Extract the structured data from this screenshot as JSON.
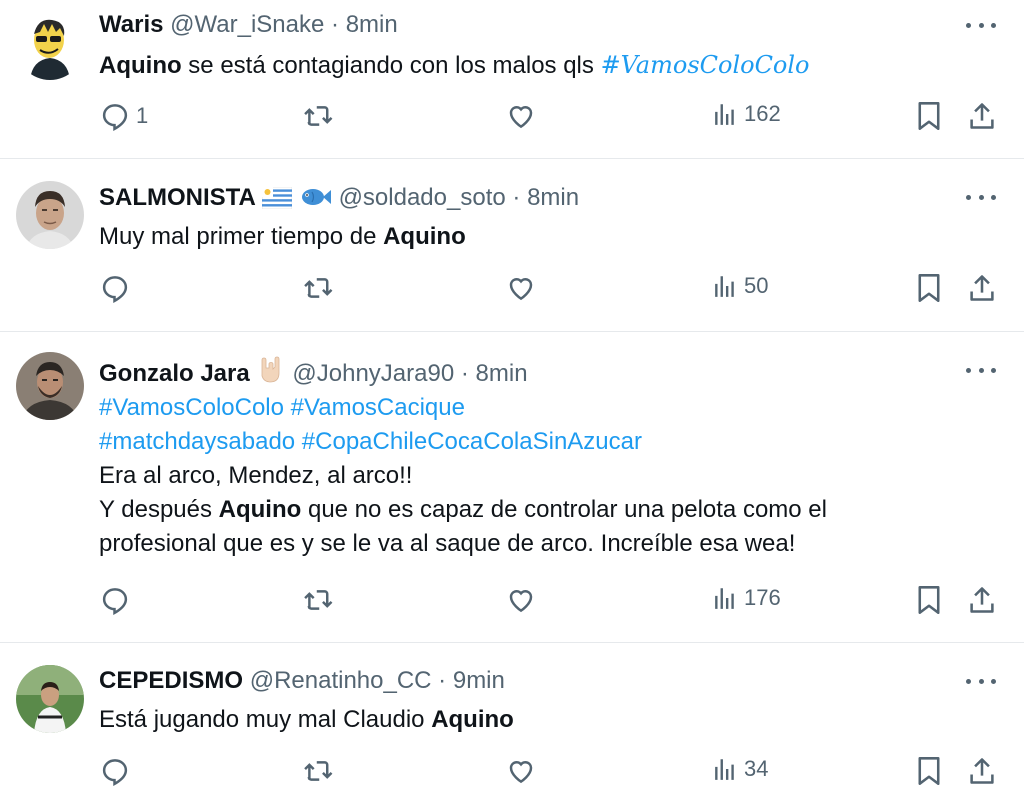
{
  "tweets": [
    {
      "name": "Waris",
      "handle": "@War_iSnake",
      "sep": "·",
      "time": "8min",
      "body_bold": "Aquino",
      "body_text": " se está contagiando con los malos qls ",
      "hashtag": "#VamosColoColo",
      "replies": "1",
      "views": "162"
    },
    {
      "name": "SALMONISTA",
      "handle": "@soldado_soto",
      "sep": "·",
      "time": "8min",
      "body_text": "Muy mal primer tiempo de ",
      "body_bold": "Aquino",
      "views": "50"
    },
    {
      "name": "Gonzalo Jara",
      "handle": "@JohnyJara90",
      "sep": "·",
      "time": "8min",
      "hashtags_line1": "#VamosColoColo #VamosCacique",
      "hashtags_line2": "#matchdaysabado #CopaChileCocaColaSinAzucar",
      "line3": "Era al arco, Mendez, al arco!!",
      "line4_pre": "Y después ",
      "line4_bold": "Aquino",
      "line4_post": " que no es capaz de controlar una pelota como el",
      "line5": "profesional que es y se le va al saque de arco. Increíble esa wea!",
      "views": "176"
    },
    {
      "name": "CEPEDISMO",
      "handle": "@Renatinho_CC",
      "sep": "·",
      "time": "9min",
      "body_text": "Está jugando muy mal Claudio ",
      "body_bold": "Aquino",
      "views": "34"
    }
  ],
  "icons": {
    "reply": "reply-icon",
    "retweet": "retweet-icon",
    "like": "heart-icon",
    "views": "views-icon",
    "bookmark": "bookmark-icon",
    "share": "share-icon",
    "more": "more-icon"
  },
  "colors": {
    "link": "#1d9bf0",
    "secondary": "#536471",
    "text": "#0f1419"
  }
}
